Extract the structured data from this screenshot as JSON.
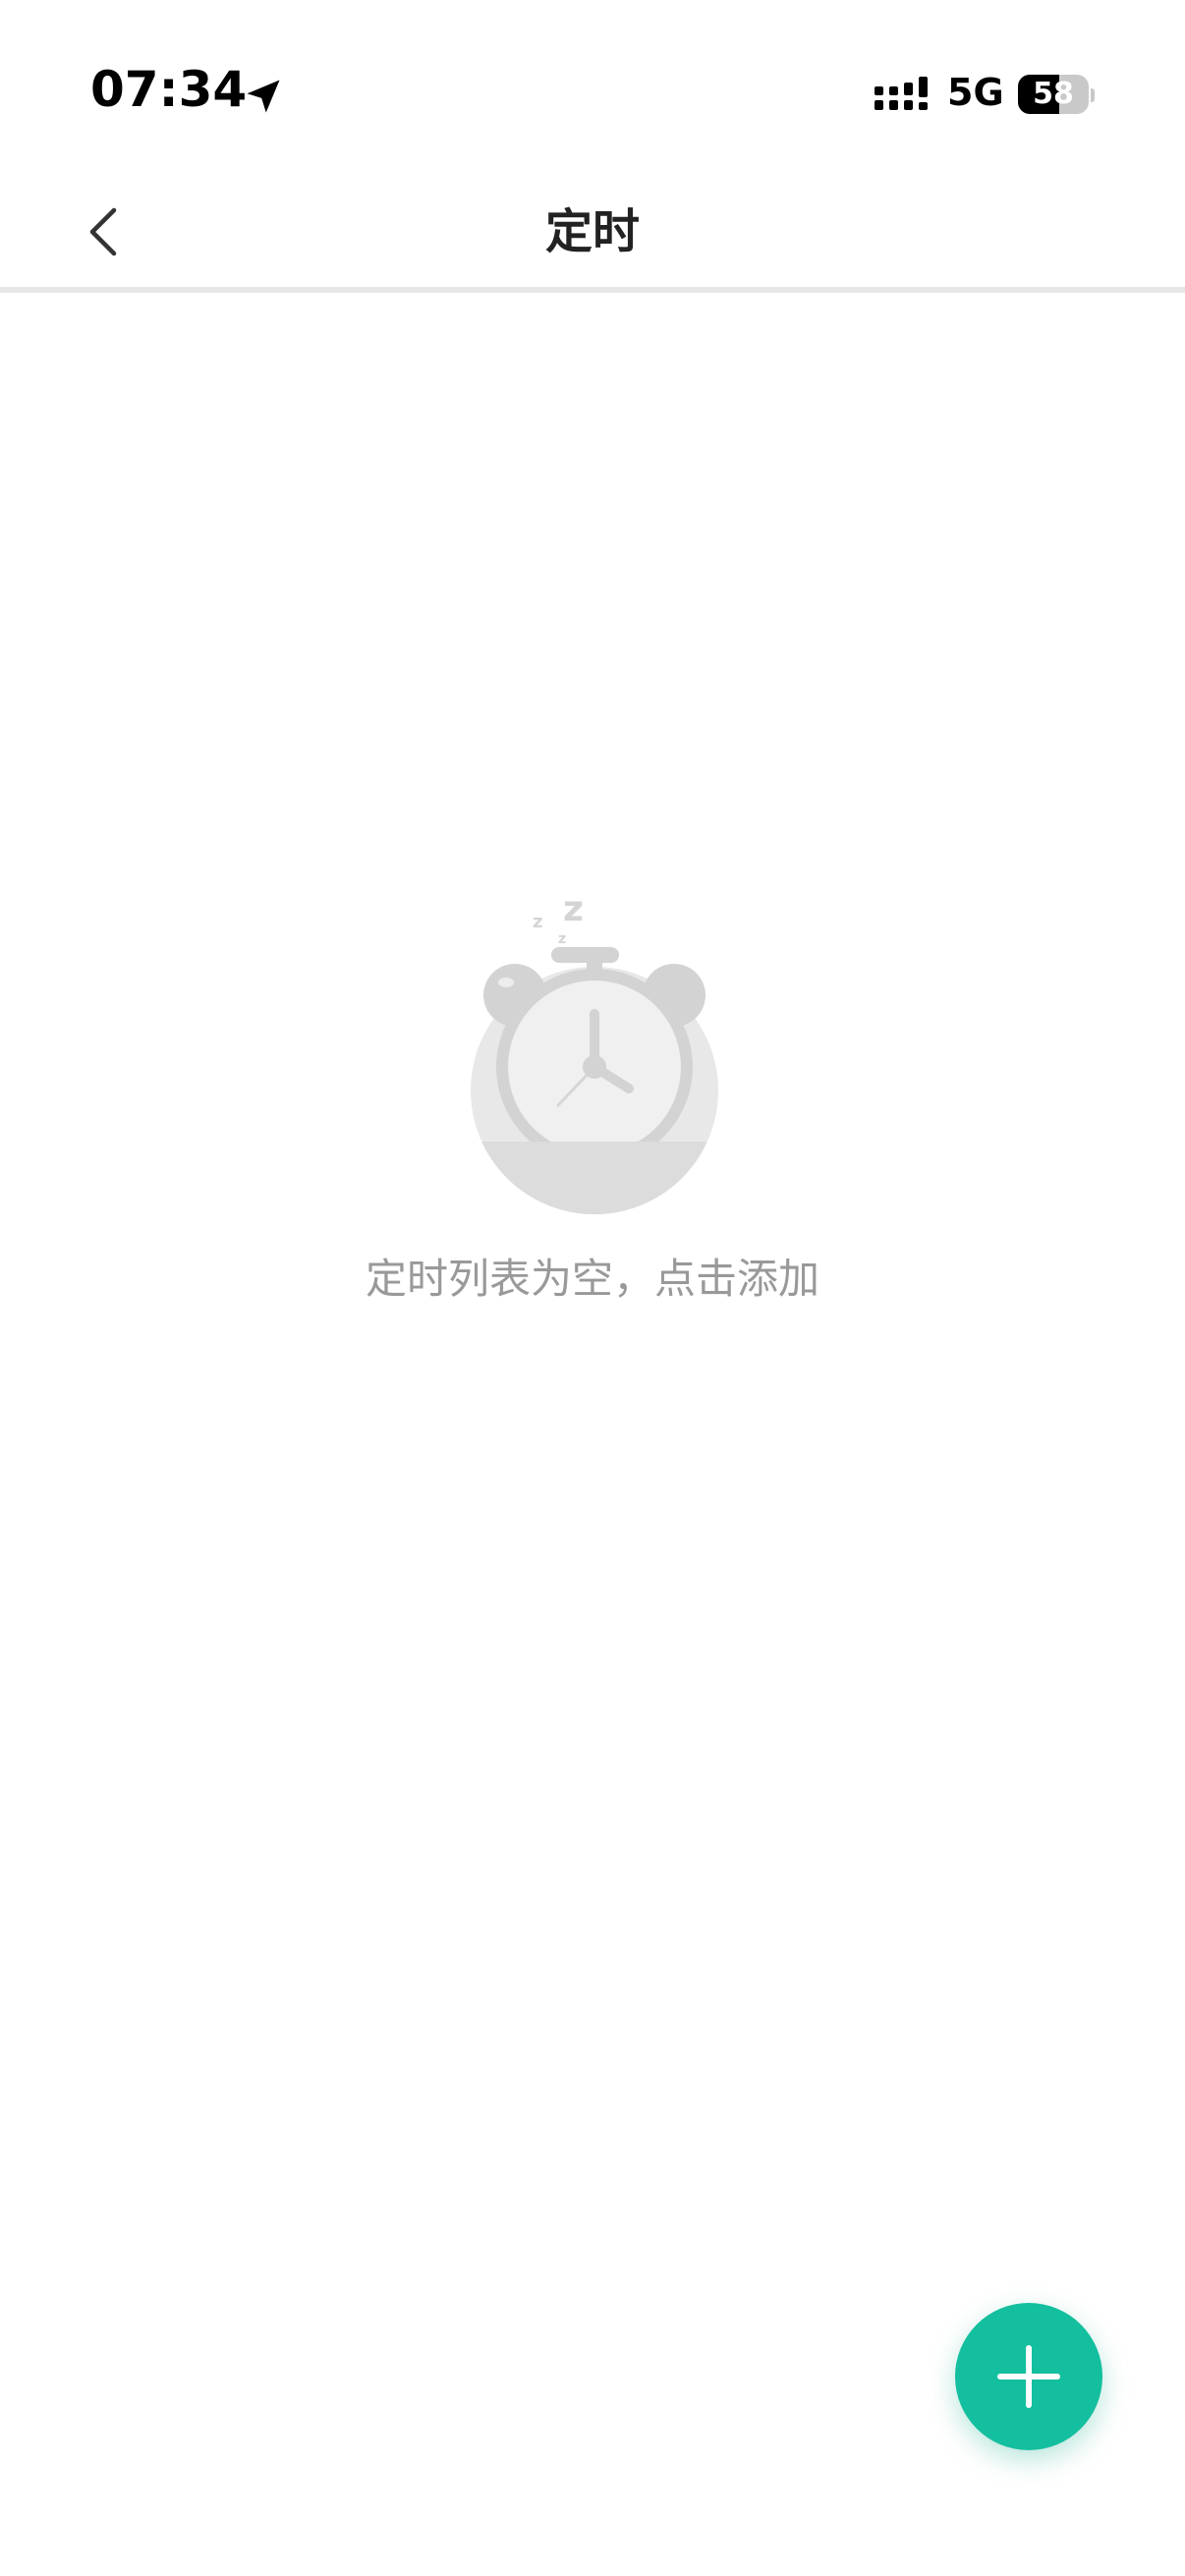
{
  "status_bar": {
    "time": "07:34",
    "network": "5G",
    "battery_level": "58",
    "battery_fraction": 0.58,
    "icons": [
      "location-arrow-icon",
      "signal-strength-icon",
      "battery-icon"
    ]
  },
  "nav": {
    "title": "定时",
    "back_icon": "chevron-left-icon"
  },
  "empty_state": {
    "icon": "sleeping-alarm-clock-icon",
    "message": "定时列表为空，点击添加"
  },
  "fab": {
    "icon": "plus-icon"
  },
  "colors": {
    "accent": "#13BF9E",
    "empty_text": "#999999",
    "title_text": "#222222",
    "divider": "#E6E6E6"
  }
}
